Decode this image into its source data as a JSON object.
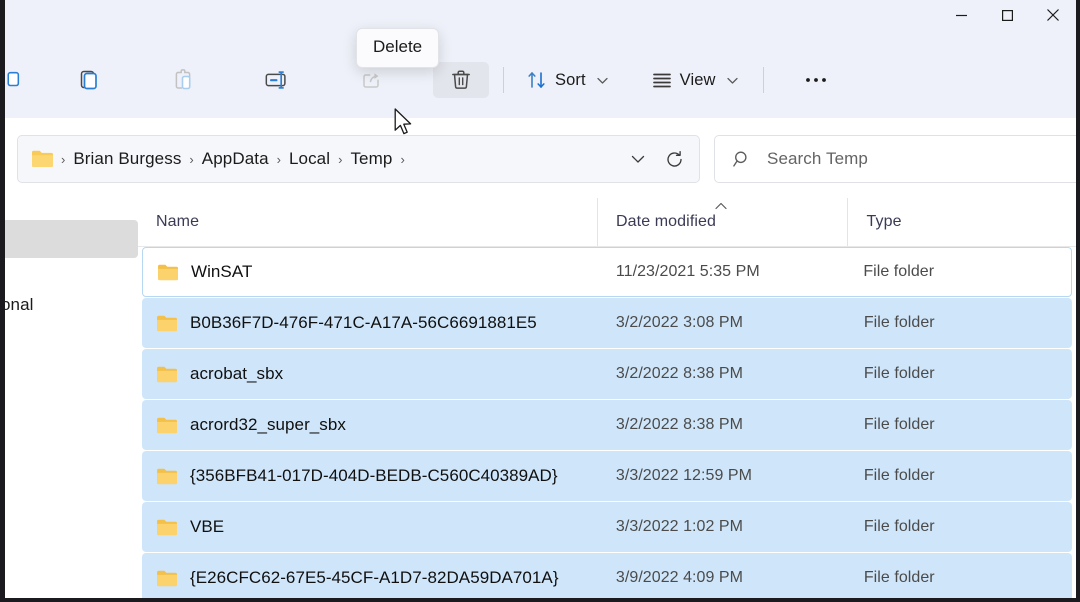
{
  "window": {
    "controls": {
      "minimize_label": "Minimize",
      "maximize_label": "Maximize",
      "close_label": "Close"
    }
  },
  "toolbar": {
    "items": [
      {
        "name": "copy",
        "label": "Copy",
        "icon": "copy-icon",
        "enabled": true
      },
      {
        "name": "paste",
        "label": "Paste",
        "icon": "paste-icon",
        "enabled": false
      },
      {
        "name": "rename",
        "label": "Rename",
        "icon": "rename-icon",
        "enabled": true
      },
      {
        "name": "share",
        "label": "Share",
        "icon": "share-icon",
        "enabled": false
      },
      {
        "name": "delete",
        "label": "Delete",
        "icon": "trash-icon",
        "enabled": true
      }
    ],
    "sort_label": "Sort",
    "view_label": "View",
    "more_label": "See more",
    "tooltip": "Delete"
  },
  "address": {
    "crumbs": [
      "Brian Burgess",
      "AppData",
      "Local",
      "Temp"
    ],
    "separator": "›",
    "history_label": "Previous locations",
    "refresh_label": "Refresh"
  },
  "search": {
    "placeholder": "Search Temp",
    "value": ""
  },
  "navpane": {
    "partial_item_label": "onal"
  },
  "columns": [
    {
      "key": "name",
      "label": "Name",
      "sorted": false
    },
    {
      "key": "date",
      "label": "Date modified",
      "sorted": true,
      "direction": "asc"
    },
    {
      "key": "type",
      "label": "Type",
      "sorted": false
    }
  ],
  "files": [
    {
      "name": "WinSAT",
      "date": "11/23/2021 5:35 PM",
      "type": "File folder",
      "selected": false,
      "focused": true
    },
    {
      "name": "B0B36F7D-476F-471C-A17A-56C6691881E5",
      "date": "3/2/2022 3:08 PM",
      "type": "File folder",
      "selected": true,
      "focused": false
    },
    {
      "name": "acrobat_sbx",
      "date": "3/2/2022 8:38 PM",
      "type": "File folder",
      "selected": true,
      "focused": false
    },
    {
      "name": "acrord32_super_sbx",
      "date": "3/2/2022 8:38 PM",
      "type": "File folder",
      "selected": true,
      "focused": false
    },
    {
      "name": "{356BFB41-017D-404D-BEDB-C560C40389AD}",
      "date": "3/3/2022 12:59 PM",
      "type": "File folder",
      "selected": true,
      "focused": false
    },
    {
      "name": "VBE",
      "date": "3/3/2022 1:02 PM",
      "type": "File folder",
      "selected": true,
      "focused": false
    },
    {
      "name": "{E26CFC62-67E5-45CF-A1D7-82DA59DA701A}",
      "date": "3/9/2022 4:09 PM",
      "type": "File folder",
      "selected": true,
      "focused": false
    }
  ],
  "colors": {
    "toolbar_bg": "#eef1f9",
    "selection_blue": "#cfe6fa",
    "folder_yellow": "#f7ca5a",
    "accent_blue": "#0f6cbd",
    "frame": "#1b1b1f"
  }
}
